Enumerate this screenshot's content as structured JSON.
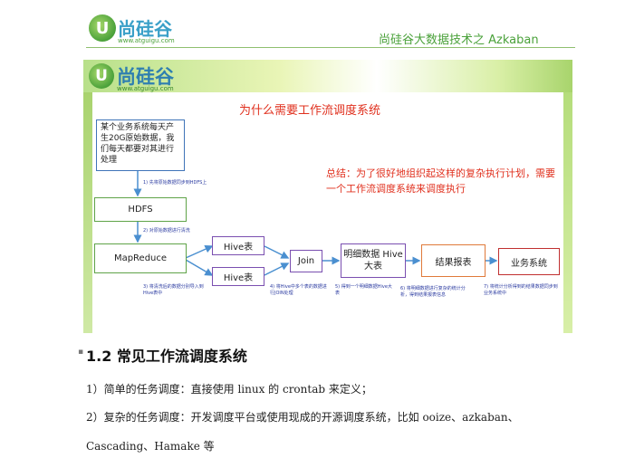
{
  "header": {
    "logo_letter": "U",
    "logo_name": "尚硅谷",
    "logo_url": "www.atguigu.com",
    "title": "尚硅谷大数据技术之 Azkaban"
  },
  "slide": {
    "logo_letter": "U",
    "logo_name": "尚硅谷",
    "logo_url": "www.atguigu.com",
    "title": "为什么需要工作流调度系统",
    "summary": "总结：为了很好地组织起这样的复杂执行计划，需要一个工作流调度系统来调度执行",
    "boxes": {
      "business": "某个业务系统每天产生20G原始数据，我们每天都要对其进行处理",
      "hdfs": "HDFS",
      "mapreduce": "MapReduce",
      "hive1": "Hive表",
      "hive2": "Hive表",
      "join": "Join",
      "detail": "明细数据 Hive大表",
      "report": "结果报表",
      "biz_system": "业务系统"
    },
    "notes": {
      "n1": "1) 先将原始数据同步到HDFS上",
      "n2": "2) 对原始数据进行清洗",
      "n3": "3) 将清洗后的数据分别导入到Hive表中",
      "n4": "4) 将Hive中多个表的数据进行JOIN处理",
      "n5": "5) 得到一个明细数据Hive大表",
      "n6": "6) 将明细数据进行复杂的统计分析，得到结果报表信息",
      "n7": "7) 将统计分析得到的结果数据同步到业务系统中"
    }
  },
  "doc": {
    "heading": "1.2 常见工作流调度系统",
    "line1": "1）简单的任务调度：直接使用 linux 的 crontab 来定义；",
    "line2": "2）复杂的任务调度：开发调度平台或使用现成的开源调度系统，比如 ooize、azkaban、",
    "line3": "Cascading、Hamake 等"
  }
}
